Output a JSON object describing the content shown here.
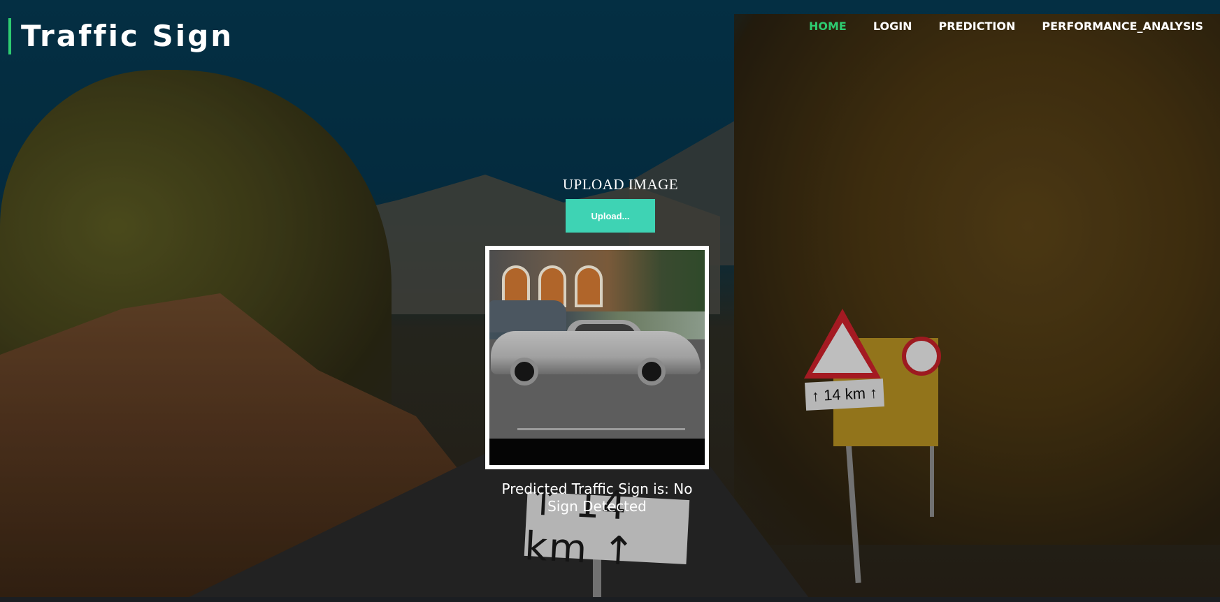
{
  "header": {
    "brand": "Traffic Sign",
    "nav": [
      {
        "label": "HOME",
        "active": true
      },
      {
        "label": "LOGIN",
        "active": false
      },
      {
        "label": "PREDICTION",
        "active": false
      },
      {
        "label": "PERFORMANCE_ANALYSIS",
        "active": false
      }
    ]
  },
  "upload": {
    "title": "UPLOAD IMAGE",
    "button_label": "Upload..."
  },
  "result": {
    "text": "Predicted Traffic Sign is: No Sign Detected"
  },
  "background": {
    "road_sign_text": "↑ 14 km ↑",
    "small_sign_text": "↑ 14 km ↑"
  },
  "colors": {
    "accent": "#2ecc71",
    "upload_button": "#3ed3b4",
    "header_text": "#ffffff"
  }
}
